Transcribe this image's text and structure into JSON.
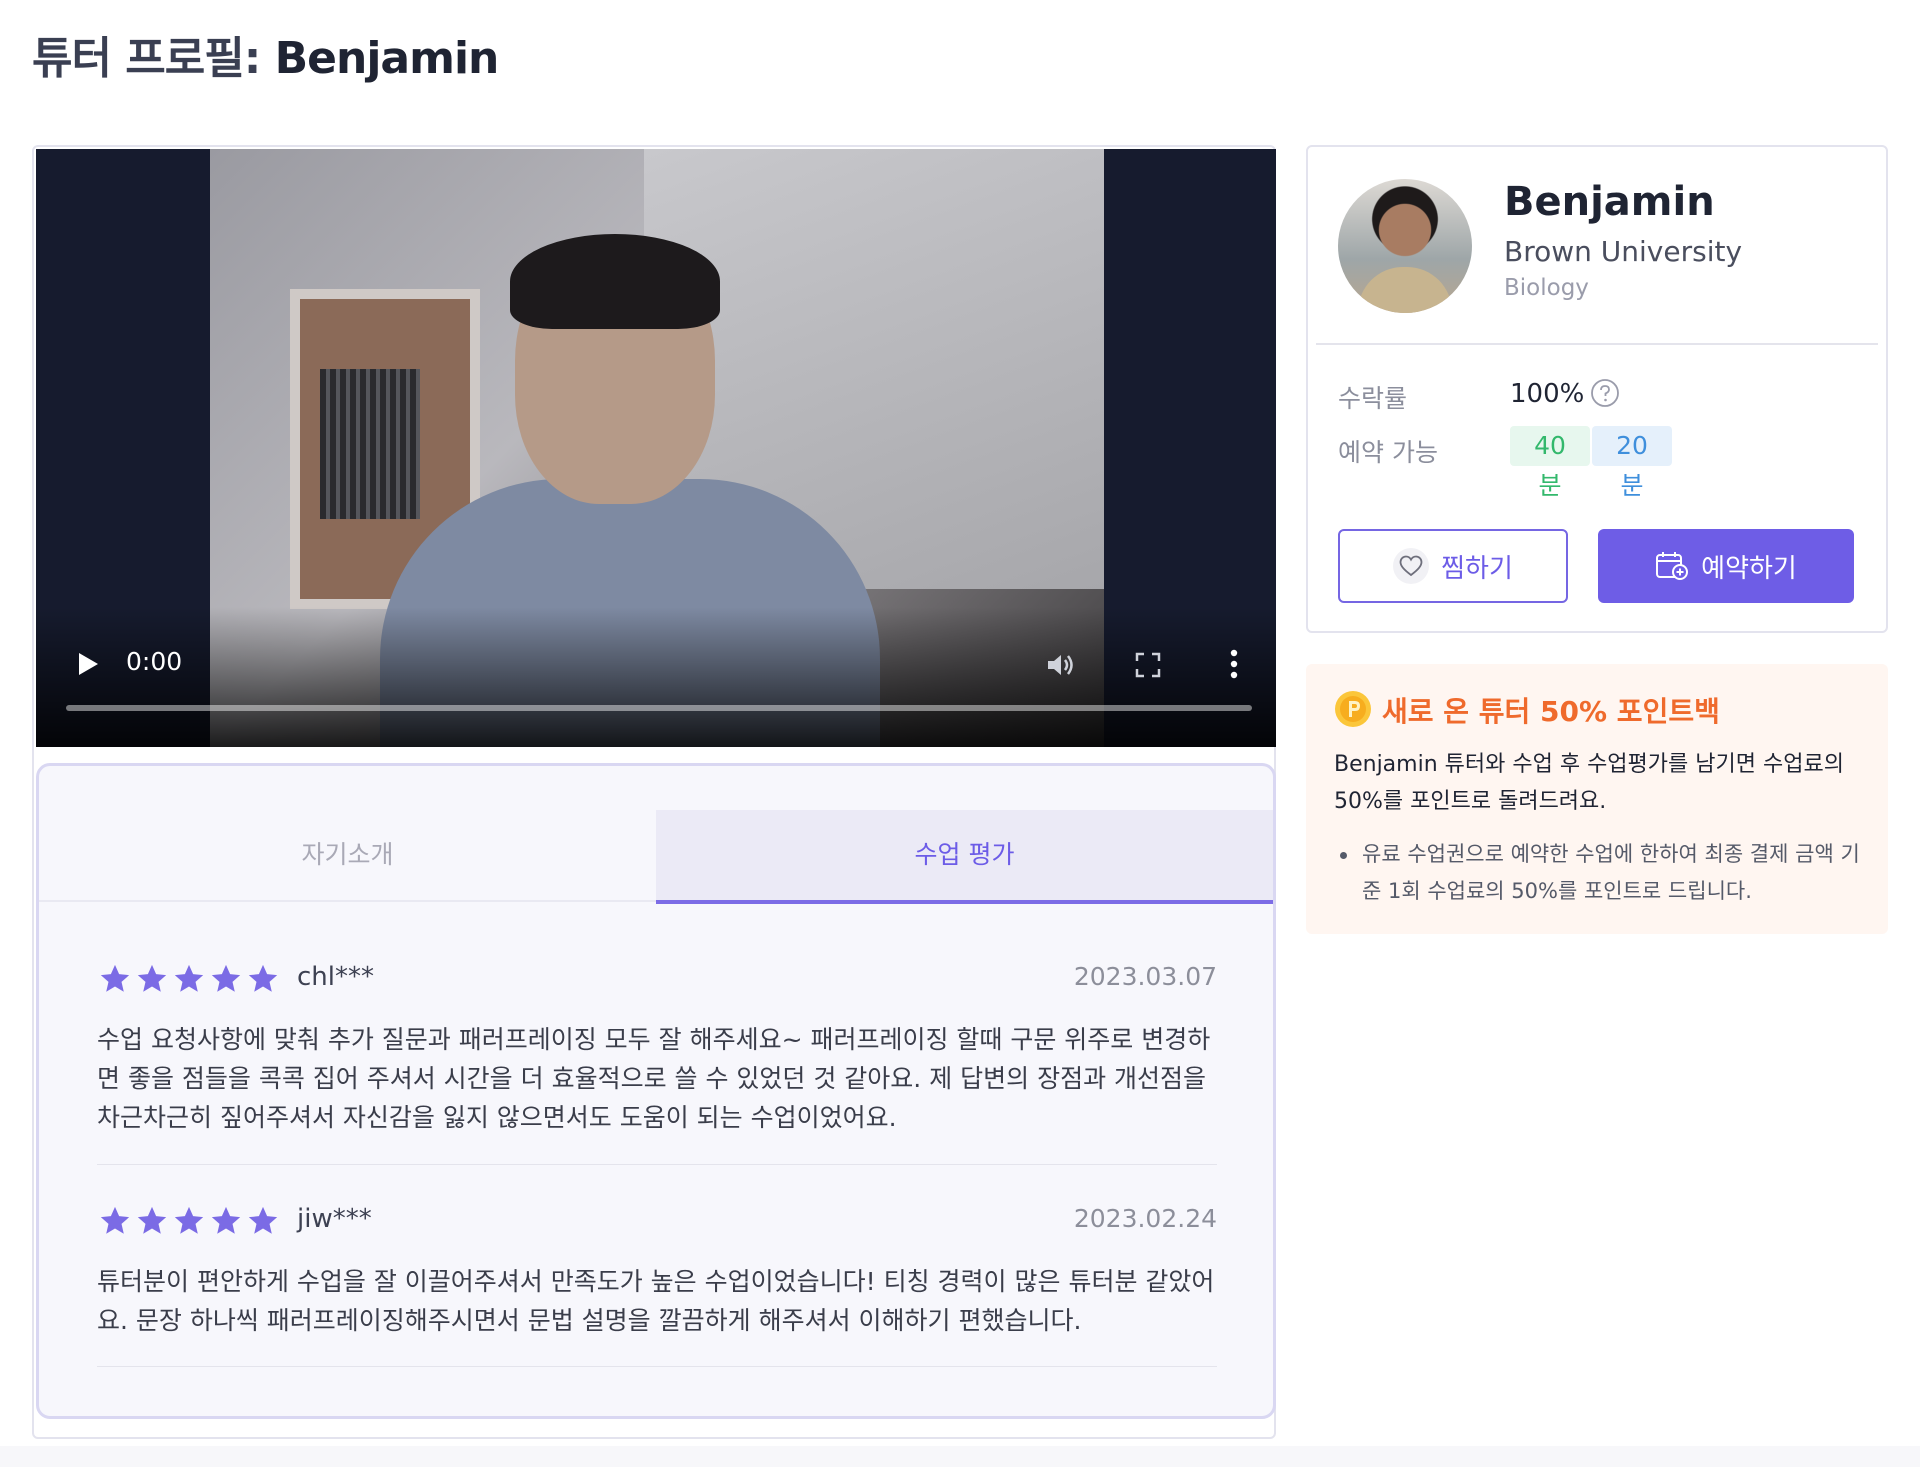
{
  "page": {
    "title_prefix": "튜터 프로필: ",
    "title_name": "Benjamin"
  },
  "video": {
    "time": "0:00",
    "progress": 0,
    "icons": [
      "play-icon",
      "volume-icon",
      "fullscreen-icon",
      "more-vert-icon"
    ]
  },
  "tabs": [
    {
      "label": "자기소개",
      "active": false
    },
    {
      "label": "수업 평가",
      "active": true
    }
  ],
  "reviews": [
    {
      "rating": 5,
      "reviewer": "chl***",
      "date": "2023.03.07",
      "text": "수업 요청사항에 맞춰 추가 질문과 패러프레이징 모두 잘 해주세요~ 패러프레이징 할때 구문 위주로 변경하면 좋을 점들을 콕콕 집어 주셔서 시간을 더 효율적으로 쓸 수 있었던 것 같아요. 제 답변의 장점과 개선점을 차근차근히 짚어주셔서 자신감을 잃지 않으면서도 도움이 되는 수업이었어요."
    },
    {
      "rating": 5,
      "reviewer": "jiw***",
      "date": "2023.02.24",
      "text": "튜터분이 편안하게 수업을 잘 이끌어주셔서 만족도가 높은 수업이었습니다! 티칭 경력이 많은 튜터분 같았어요. 문장 하나씩 패러프레이징해주시면서 문법 설명을 깔끔하게 해주셔서 이해하기 편했습니다."
    }
  ],
  "profile": {
    "name": "Benjamin",
    "school": "Brown University",
    "major": "Biology",
    "acceptance_label": "수락률",
    "acceptance_value": "100%",
    "availability_label": "예약 가능",
    "availability": [
      "40분",
      "20분"
    ],
    "favorite_label": "찜하기",
    "book_label": "예약하기"
  },
  "promo": {
    "title": "새로 온 튜터 50% 포인트백",
    "description": "Benjamin 튜터와 수업 후 수업평가를 남기면 수업료의 50%를 포인트로 돌려드려요.",
    "bullet": "유료 수업권으로 예약한 수업에 한하여 최종 결제 금액 기준 1회 수업료의 50%를 포인트로 드립니다."
  },
  "colors": {
    "accent": "#6e5de6",
    "star": "#7b6be5",
    "promo_orange": "#ef6a2c",
    "badge_green": "#33b86c",
    "badge_blue": "#3f8fdc"
  }
}
